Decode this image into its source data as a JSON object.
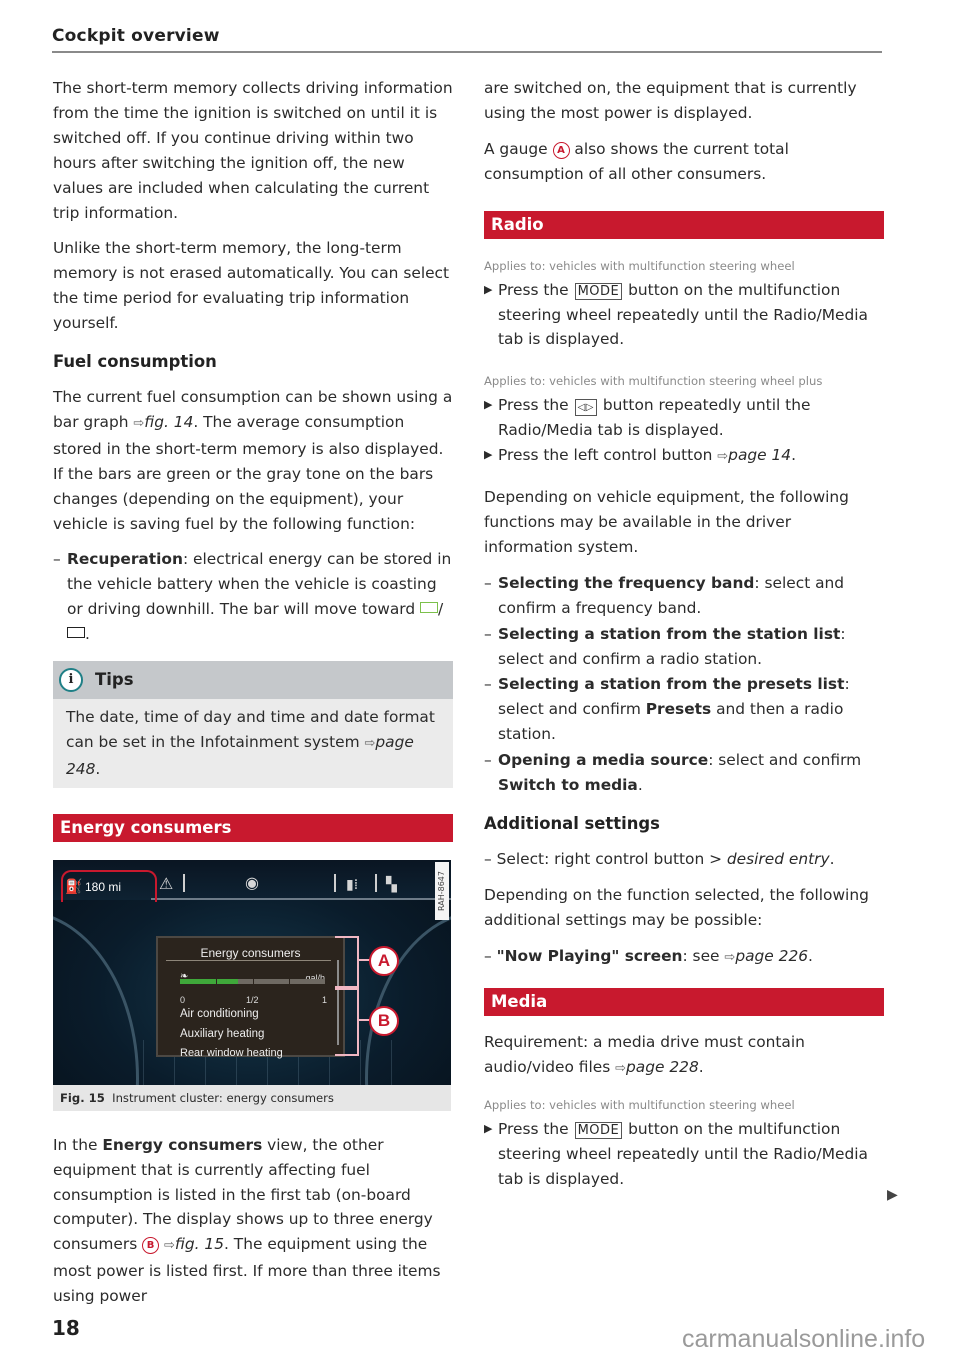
{
  "header": {
    "title": "Cockpit overview"
  },
  "left": {
    "p1": "The short-term memory collects driving information from the time the ignition is switched on until it is switched off. If you continue driving within two hours after switching the ignition off, the new values are included when calculating the current trip information.",
    "p2": "Unlike the short-term memory, the long-term memory is not erased automatically. You can select the time period for evaluating trip information yourself.",
    "fuel_heading": "Fuel consumption",
    "fuel_p_a": "The current fuel consumption can be shown using a bar graph ",
    "fuel_ref": "fig. 14",
    "fuel_p_b": ". The average consumption stored in the short-term memory is also displayed. If the bars are green or the gray tone on the bars changes (depending on the equipment), your vehicle is saving fuel by the following function:",
    "recup_term": "Recuperation",
    "recup_text": ": electrical energy can be stored in the vehicle battery when the vehicle is coasting or driving downhill. The bar will move toward ",
    "recup_slash": "/",
    "recup_end": ".",
    "tips": {
      "label": "Tips",
      "icon": "info-icon",
      "body_a": "The date, time of day and time and date format can be set in the Infotainment system ",
      "ref": "page 248",
      "body_b": "."
    },
    "energy_band": "Energy consumers",
    "figure": {
      "range": "180 mi",
      "code": "RAH-8647",
      "panel_title": "Energy consumers",
      "unit": "gal/h",
      "gauge_fraction": 0.4,
      "scale": [
        "0",
        "1/2",
        "1"
      ],
      "consumers": [
        "Air conditioning",
        "Auxiliary heating",
        "Rear window heating"
      ],
      "callouts": [
        "A",
        "B"
      ],
      "icons": [
        "fuel-pump-icon",
        "warning-icon",
        "disc-icon",
        "phone-signal-icon",
        "map-icon"
      ]
    },
    "caption_label": "Fig. 15",
    "caption_text": "Instrument cluster: energy consumers",
    "body_a": "In the ",
    "body_bold": "Energy consumers",
    "body_b": " view, the other equipment that is currently affecting fuel consumption is listed in the first tab (on-board computer). The display shows up to three energy consumers ",
    "body_callout": "B",
    "body_ref": "fig. 15",
    "body_c": ". The equipment using the most power is listed first. If more than three items using power"
  },
  "right": {
    "p1": "are switched on, the equipment that is currently using the most power is displayed.",
    "p2_a": "A gauge ",
    "p2_callout": "A",
    "p2_b": " also shows the current total consumption of all other consumers.",
    "radio_band": "Radio",
    "applies1": "Applies to: vehicles with multifunction steering wheel",
    "step1_a": "Press the ",
    "step1_key": "MODE",
    "step1_b": " button on the multifunction steering wheel repeatedly until the Radio/Media tab is displayed.",
    "applies2": "Applies to: vehicles with multifunction steering wheel plus",
    "step2_a": "Press the ",
    "step2_key": "◁▷",
    "step2_b": " button repeatedly until the Radio/Media tab is displayed.",
    "step3_a": "Press the left control button ",
    "step3_ref": "page 14",
    "step3_b": ".",
    "depending": "Depending on vehicle equipment, the following functions may be available in the driver information system.",
    "functions": [
      {
        "term": "Selecting the frequency band",
        "text": ": select and confirm a frequency band."
      },
      {
        "term": "Selecting a station from the station list",
        "text": ": select and confirm a radio station."
      },
      {
        "term": "Selecting a station from the presets list",
        "text": ": select and confirm ",
        "bold2": "Presets",
        "text2": " and then a radio station."
      },
      {
        "term": "Opening a media source",
        "text": ": select and confirm ",
        "bold2": "Switch to media",
        "text2": "."
      }
    ],
    "additional_heading": "Additional settings",
    "select_a": "Select: right control button > ",
    "select_entry": "desired entry",
    "select_b": ".",
    "depending2": "Depending on the function selected, the following additional settings may be possible:",
    "now_playing_term": "\"Now Playing\" screen",
    "now_playing_text": ": see ",
    "now_playing_ref": "page 226",
    "now_playing_end": ".",
    "media_band": "Media",
    "requirement_a": "Requirement: a media drive must contain audio/video files ",
    "requirement_ref": "page 228",
    "requirement_b": ".",
    "applies3": "Applies to: vehicles with multifunction steering wheel",
    "step4_a": "Press the ",
    "step4_key": "MODE",
    "step4_b": " button on the multifunction steering wheel repeatedly until the Radio/Media tab is displayed."
  },
  "footer": {
    "page_number": "18",
    "continue_icon": "continue-arrow-icon",
    "watermark": "carmanualsonline.info"
  },
  "colors": {
    "accent_red": "#c8192e",
    "tips_header": "#c5c8cb",
    "tips_body": "#ebebeb",
    "gauge_green": "#3fa83a"
  }
}
